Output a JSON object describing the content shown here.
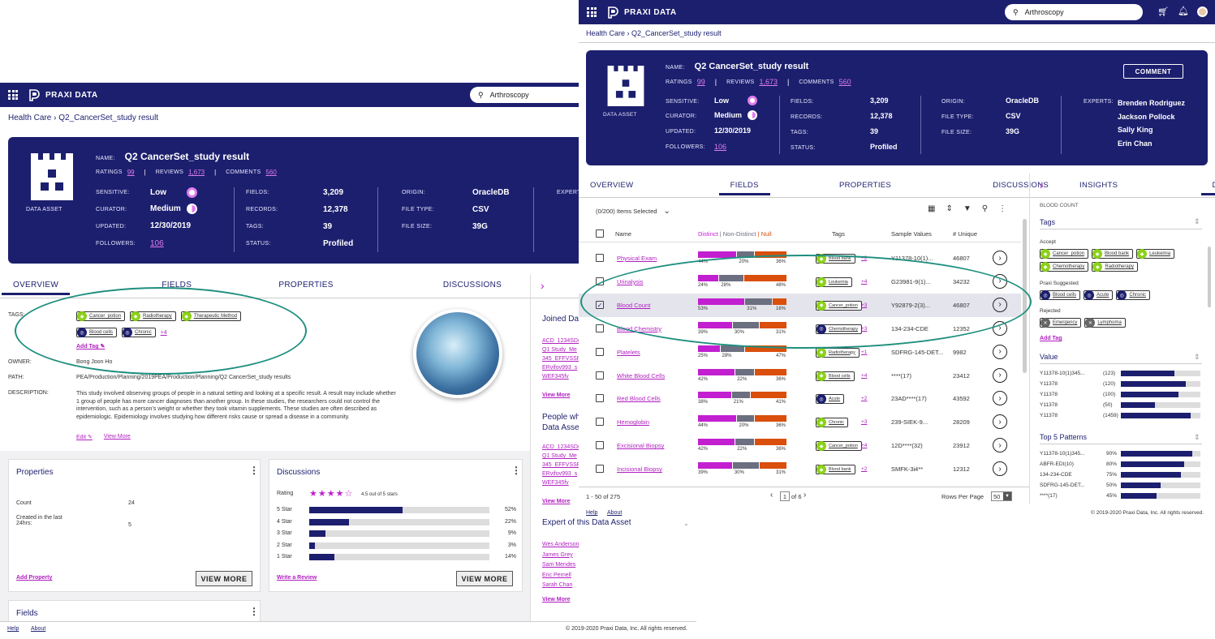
{
  "app": {
    "brand": "PRAXI DATA",
    "search_value": "Arthroscopy"
  },
  "breadcrumb": "Health Care › Q2_CancerSet_study result",
  "asset": {
    "name_label": "NAME:",
    "name": "Q2 CancerSet_study result",
    "ratings_label": "RATINGS",
    "ratings": "99",
    "reviews_label": "REVIEWS",
    "reviews": "1,673",
    "comments_label": "COMMENTS",
    "comments": "560",
    "type_label": "DATA ASSET",
    "sensitive_label": "SENSITIVE:",
    "sensitive": "Low",
    "curator_label": "CURATOR:",
    "curator": "Medium",
    "updated_label": "UPDATED:",
    "updated": "12/30/2019",
    "followers_label": "FOLLOWERS:",
    "followers": "106",
    "fields_label": "FIELDS:",
    "fields": "3,209",
    "records_label": "RECORDS:",
    "records": "12,378",
    "tags_label": "TAGS:",
    "tags": "39",
    "status_label": "STATUS:",
    "status": "Profiled",
    "origin_label": "ORIGIN:",
    "origin": "OracleDB",
    "filetype_label": "FILE TYPE:",
    "filetype": "CSV",
    "filesize_label": "FILE SIZE:",
    "filesize": "39G",
    "experts_label": "EXPERTS:",
    "experts_label_cut": "EXPERT",
    "experts": [
      "Brenden Rodriguez",
      "Jackson Pollock",
      "Sally King",
      "Erin Chan"
    ],
    "comment_btn": "COMMENT"
  },
  "tabs": [
    "OVERVIEW",
    "FIELDS",
    "PROPERTIES",
    "DISCUSSIONS"
  ],
  "left": {
    "tags_label": "TAGS:",
    "tags": [
      "Cancer_potion",
      "Radiotherapy",
      "Therapeutic Method",
      "Blood cells",
      "Chronic"
    ],
    "more_tags": "+4",
    "add_tag": "Add Tag",
    "owner_label": "OWNER:",
    "owner": "Bong Joon Ho",
    "path_label": "PATH:",
    "path": "PEA/Production/Planning/2019PEA/Production/Planning/Q2 CancerSet_study results",
    "desc_label": "DESCRIPTION:",
    "description": "This study involved observing groups of people in a natural setting and looking at a specific result. A result may include whether 1 group of people has more cancer diagnoses than another group. In these studies, the researchers could not control the intervention, such as a person’s weight or whether they took vitamin supplements. These studies are often described as epidemiologic. Epidemiology involves studying how different risks cause or spread a disease in a community.",
    "edit": "Edit",
    "view_more": "View More",
    "properties": {
      "title": "Properties",
      "count_label": "Count",
      "count": "24",
      "created_label": "Created in the last 24hrs:",
      "created": "5",
      "add": "Add Property",
      "view_more": "VIEW MORE"
    },
    "discussions": {
      "title": "Discussions",
      "rating_label": "Rating",
      "rating_text": "4.5 out of 5 stars",
      "write": "Write a Review",
      "view_more": "VIEW MORE",
      "rows": [
        {
          "label": "5 Star",
          "pct": 52,
          "text": "52%"
        },
        {
          "label": "4 Star",
          "pct": 22,
          "text": "22%"
        },
        {
          "label": "3 Star",
          "pct": 9,
          "text": "9%"
        },
        {
          "label": "2 Star",
          "pct": 3,
          "text": "3%"
        },
        {
          "label": "1 Star",
          "pct": 14,
          "text": "14%"
        }
      ]
    },
    "fields_card_title": "Fields",
    "side": {
      "joined_title": "Joined Da",
      "joined_links": [
        "ACD_1234SD(",
        "Q1 Study_Me",
        "345_EFFVSSPf",
        "ERvifov993_s",
        "WEF345fv"
      ],
      "view_more": "View More",
      "people_title": "People wh",
      "people_title2": "Data Asse",
      "people_links": [
        "ACD_1234SD(",
        "Q1 Study_Me",
        "345_EFFVSSPf",
        "ERvifov993_s",
        "WEF345fv"
      ],
      "expert_title": "Expert of this Data Asset",
      "expert_links": [
        "Wes Anderson",
        "James Grey",
        "Sam Mendes",
        "Eric Pernell",
        "Sarah Chan"
      ]
    },
    "footer": {
      "help": "Help",
      "about": "About",
      "copyright": "© 2019-2020 Praxi Data, Inc. All rights reserved."
    }
  },
  "fields_view": {
    "selected": "(0/200) Items Selected",
    "headers": {
      "name": "Name",
      "distinct": "Distinct",
      "nondistinct": "Non-Distinct",
      "null": "Null",
      "tags": "Tags",
      "sample": "Sample Values",
      "unique": "# Unique"
    },
    "rows": [
      {
        "name": "Physical Exam",
        "d": 44,
        "n": 20,
        "u": 36,
        "dt": "44%",
        "nt": "20%",
        "ut": "36%",
        "tag": "Blood bank",
        "tc": "tg",
        "more": "+2",
        "sample": "Y11378-10(1)...",
        "unique": "46807",
        "checked": false
      },
      {
        "name": "Urinalysis",
        "d": 24,
        "n": 28,
        "u": 48,
        "dt": "24%",
        "nt": "28%",
        "ut": "48%",
        "tag": "Leukemia",
        "tc": "tg",
        "more": "+4",
        "sample": "G23981-9(1)...",
        "unique": "34232",
        "checked": false
      },
      {
        "name": "Blood Count",
        "d": 53,
        "n": 31,
        "u": 16,
        "dt": "53%",
        "nt": "31%",
        "ut": "16%",
        "tag": "Cancer_potion",
        "tc": "tg",
        "more": "+3",
        "sample": "Y92879-2(3)...",
        "unique": "46807",
        "checked": true
      },
      {
        "name": "Blood Chemistry",
        "d": 39,
        "n": 30,
        "u": 31,
        "dt": "39%",
        "nt": "30%",
        "ut": "31%",
        "tag": "Chemotherapy",
        "tc": "tb",
        "more": "+3",
        "sample": "134-234-CDE",
        "unique": "12352",
        "checked": false
      },
      {
        "name": "Platelets",
        "d": 25,
        "n": 28,
        "u": 47,
        "dt": "25%",
        "nt": "28%",
        "ut": "47%",
        "tag": "Radiotherapy",
        "tc": "tg",
        "more": "+1",
        "sample": "SDFRG-145-DET...",
        "unique": "9982",
        "checked": false
      },
      {
        "name": "White Blood Cells",
        "d": 42,
        "n": 22,
        "u": 36,
        "dt": "42%",
        "nt": "22%",
        "ut": "36%",
        "tag": "Blood cells",
        "tc": "tg",
        "more": "+4",
        "sample": "****(17)",
        "unique": "23412",
        "checked": false
      },
      {
        "name": "Red Blood Cells",
        "d": 38,
        "n": 21,
        "u": 41,
        "dt": "38%",
        "nt": "21%",
        "ut": "41%",
        "tag": "Acute",
        "tc": "tb",
        "more": "+2",
        "sample": "23AD****(17)",
        "unique": "43592",
        "checked": false
      },
      {
        "name": "Hemoglobin",
        "d": 44,
        "n": 20,
        "u": 36,
        "dt": "44%",
        "nt": "20%",
        "ut": "36%",
        "tag": "Chronic",
        "tc": "tg",
        "more": "+3",
        "sample": "239-SIEK-9...",
        "unique": "28209",
        "checked": false
      },
      {
        "name": "Excisional Biopsy",
        "d": 42,
        "n": 22,
        "u": 36,
        "dt": "42%",
        "nt": "22%",
        "ut": "36%",
        "tag": "Cancer_potion",
        "tc": "tg",
        "more": "+4",
        "sample": "12D****(32)",
        "unique": "23912",
        "checked": false
      },
      {
        "name": "Incisional Biopsy",
        "d": 39,
        "n": 30,
        "u": 31,
        "dt": "39%",
        "nt": "30%",
        "ut": "31%",
        "tag": "Blood bank",
        "tc": "tg",
        "more": "+2",
        "sample": "SMFK-3i4**",
        "unique": "12312",
        "checked": false
      }
    ],
    "pager": {
      "range": "1 - 50 of 275",
      "page": "1",
      "of": "of 6",
      "rpp_label": "Rows Per Page",
      "rpp": "50"
    },
    "footer": {
      "help": "Help",
      "about": "About",
      "copyright": "© 2019-2020 Praxi Data, Inc. All rights reserved."
    }
  },
  "details": {
    "tabs": [
      "INSIGHTS",
      "DETAILS"
    ],
    "field": "BLOOD COUNT",
    "tags_title": "Tags",
    "accept_label": "Accept",
    "accept": [
      "Cancer_potion",
      "Blood bank",
      "Leukemia",
      "Chemotherapy",
      "Radiotherapy"
    ],
    "suggested_label": "Praxi Suggested",
    "suggested": [
      "Blood cells",
      "Acute",
      "Chronic"
    ],
    "rejected_label": "Rejected",
    "rejected": [
      "Emergency",
      "Lymphoma"
    ],
    "add_tag": "Add Tag",
    "value_title": "Value",
    "values": [
      {
        "label": "Y11378-10(1)345...",
        "count": "(123)",
        "pct": 67
      },
      {
        "label": "Y11378",
        "count": "(120)",
        "pct": 82
      },
      {
        "label": "Y11378",
        "count": "(100)",
        "pct": 72
      },
      {
        "label": "Y11378",
        "count": "(50)",
        "pct": 43
      },
      {
        "label": "Y11378",
        "count": "(1459)",
        "pct": 88
      }
    ],
    "patterns_title": "Top 5 Patterns",
    "patterns": [
      {
        "label": "Y11378-10(1)345...",
        "pct_text": "90%",
        "pct": 90
      },
      {
        "label": "ABFR-EDI(10)",
        "pct_text": "80%",
        "pct": 80
      },
      {
        "label": "134-234-CDE",
        "pct_text": "75%",
        "pct": 75
      },
      {
        "label": "SDFRG-145-DET...",
        "pct_text": "50%",
        "pct": 50
      },
      {
        "label": "****(17)",
        "pct_text": "45%",
        "pct": 45
      }
    ]
  },
  "colors": {
    "navy": "#1c1f6e",
    "magenta": "#c21fd0",
    "gray": "#6b6f80",
    "orange": "#d94f0b",
    "green": "#8cd11a",
    "teal": "#1f8f7f"
  }
}
